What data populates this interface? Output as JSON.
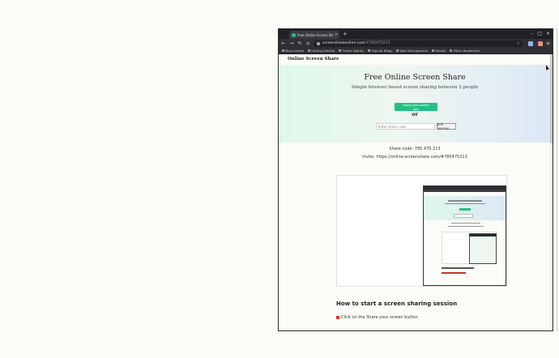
{
  "browser": {
    "tab_title": "Free Online Screen Share",
    "tab_close": "×",
    "new_tab": "+",
    "window_controls": [
      "–",
      "□",
      "×"
    ],
    "url_host": "screenshareonline.com",
    "url_path": "/#785475213",
    "bookmarks": [
      "Most visited",
      "Getting Started",
      "Firefox Nightly",
      "Popular Blogs",
      "Web Development",
      "Mozilla",
      "Other Bookmarks"
    ]
  },
  "page": {
    "brand": "Online Screen Share",
    "hero_title": "Free Online Screen Share",
    "hero_subtitle": "Simple browser based screen sharing between 2 people",
    "primary_button": "Share your screen now",
    "or_label": "or",
    "join_placeholder": "Enter share code",
    "join_button": "Join session",
    "share_code": "Share code: 785 475 213",
    "invite_link": "Invite: https://online-screenshare.com/#785475213",
    "section_title": "How to start a screen sharing session",
    "step_1": "Click on the Share your screen button"
  },
  "colors": {
    "accent": "#24bf86",
    "step_marker": "#e0332b"
  }
}
